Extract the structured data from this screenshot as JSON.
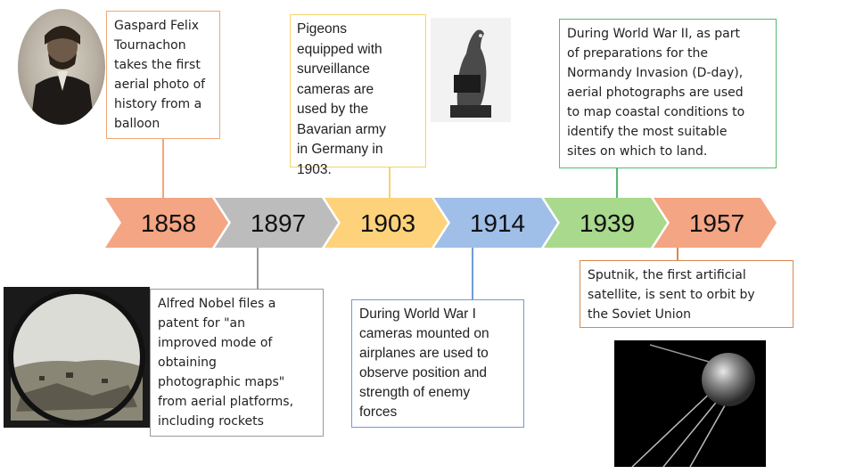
{
  "colors": {
    "salmon": "#f4a583",
    "gray": "#bcbcbc",
    "yellow": "#fdd27a",
    "blue": "#9fbfe8",
    "green": "#a8d98c",
    "c1858": "#f4a583",
    "c1897": "#bcbcbc",
    "c1903": "#fdd27a",
    "c1914": "#9fbfe8",
    "c1939": "#a8d98c",
    "c1957": "#f4a583",
    "b1858": "#f0a878",
    "b1897": "#999999",
    "b1903": "#f6d36a",
    "b1914": "#6f9bd6",
    "b1939": "#56b870",
    "b1957": "#d9884f"
  },
  "timeline": {
    "years": [
      "1858",
      "1897",
      "1903",
      "1914",
      "1939",
      "1957"
    ]
  },
  "events": {
    "e1858": "Gaspard Felix\nTournachon\ntakes the first\naerial photo of\nhistory from a\nballoon",
    "e1897": "Alfred Nobel files a\npatent for \"an\nimproved mode of\nobtaining\nphotographic maps\"\nfrom aerial platforms,\nincluding rockets",
    "e1903": "Pigeons\nequipped with\nsurveillance\ncameras are\nused by the\nBavarian army\nin Germany in\n1903.",
    "e1914": "During World War I\ncameras mounted on\nairplanes are used to\nobserve position and\nstrength of enemy\nforces",
    "e1939": "During World War II, as part\nof preparations for the\nNormandy Invasion (D-day),\naerial photographs are used\nto map coastal conditions to\nidentify the most suitable\nsites on which to land.",
    "e1957": "Sputnik, the first artificial\nsatellite, is sent to orbit by\nthe Soviet Union"
  }
}
